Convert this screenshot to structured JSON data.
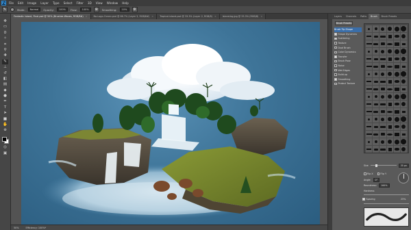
{
  "app": {
    "logo": "Ps"
  },
  "menu": [
    "File",
    "Edit",
    "Image",
    "Layer",
    "Type",
    "Select",
    "Filter",
    "3D",
    "View",
    "Window",
    "Help"
  ],
  "options_bar": {
    "tool_icon": "brush-icon",
    "mode_label": "Mode:",
    "mode_value": "Normal",
    "opacity_label": "Opacity:",
    "opacity_value": "100%",
    "flow_label": "Flow:",
    "flow_value": "100%",
    "smoothing_label": "Smoothing:",
    "smoothing_value": "10%"
  },
  "tabs": [
    {
      "label": "Fantastic Island, Final.psd @ 50% (Brushes Waves, RGB/8#)",
      "active": true
    },
    {
      "label": "No-Logo-Ocean.psd @ 66.7% (Layer 3, RGB/8#)",
      "active": false
    },
    {
      "label": "Tropical-island.psd @ 33.3% (Layer 2, RGB/8)",
      "active": false
    },
    {
      "label": "Island-bg.jpg @ 33.3% (RGB/8)",
      "active": false
    }
  ],
  "tools": [
    "move-icon",
    "marquee-icon",
    "lasso-icon",
    "quick-select-icon",
    "crop-icon",
    "eyedropper-icon",
    "healing-icon",
    "brush-icon",
    "stamp-icon",
    "history-brush-icon",
    "eraser-icon",
    "gradient-icon",
    "blur-icon",
    "dodge-icon",
    "pen-icon",
    "type-icon",
    "path-select-icon",
    "shape-icon",
    "hand-icon",
    "zoom-icon"
  ],
  "status": {
    "zoom": "50%",
    "doc": "Efficiency: 100%*"
  },
  "panel": {
    "tabs": [
      "Layers",
      "Channels",
      "Paths",
      "Brush",
      "Brush Presets"
    ],
    "active_tab": "Brush",
    "presets_button": "Brush Presets",
    "options": [
      {
        "label": "Brush Tip Shape",
        "checkbox": false,
        "checked": false,
        "selected": true
      },
      {
        "label": "Shape Dynamics",
        "checkbox": true,
        "checked": true,
        "selected": false
      },
      {
        "label": "Scattering",
        "checkbox": true,
        "checked": true,
        "selected": false
      },
      {
        "label": "Texture",
        "checkbox": true,
        "checked": false,
        "selected": false
      },
      {
        "label": "Dual Brush",
        "checkbox": true,
        "checked": false,
        "selected": false
      },
      {
        "label": "Color Dynamics",
        "checkbox": true,
        "checked": false,
        "selected": false
      },
      {
        "label": "Transfer",
        "checkbox": true,
        "checked": true,
        "selected": false
      },
      {
        "label": "Brush Pose",
        "checkbox": true,
        "checked": false,
        "selected": false
      },
      {
        "label": "Noise",
        "checkbox": true,
        "checked": false,
        "selected": false
      },
      {
        "label": "Wet Edges",
        "checkbox": true,
        "checked": false,
        "selected": false
      },
      {
        "label": "Build-up",
        "checkbox": true,
        "checked": false,
        "selected": false
      },
      {
        "label": "Smoothing",
        "checkbox": true,
        "checked": true,
        "selected": false
      },
      {
        "label": "Protect Texture",
        "checkbox": true,
        "checked": false,
        "selected": false
      }
    ],
    "size_label": "Size",
    "size_value": "35 px",
    "flip_x": "Flip X",
    "flip_y": "Flip Y",
    "angle_label": "Angle:",
    "angle_value": "0°",
    "roundness_label": "Roundness:",
    "roundness_value": "100%",
    "hardness_label": "Hardness",
    "spacing_label": "Spacing",
    "spacing_value": "25%"
  },
  "colors": {
    "accent": "#3b6ea8",
    "sea": "#3e7498",
    "panel": "#5a5a5a"
  }
}
